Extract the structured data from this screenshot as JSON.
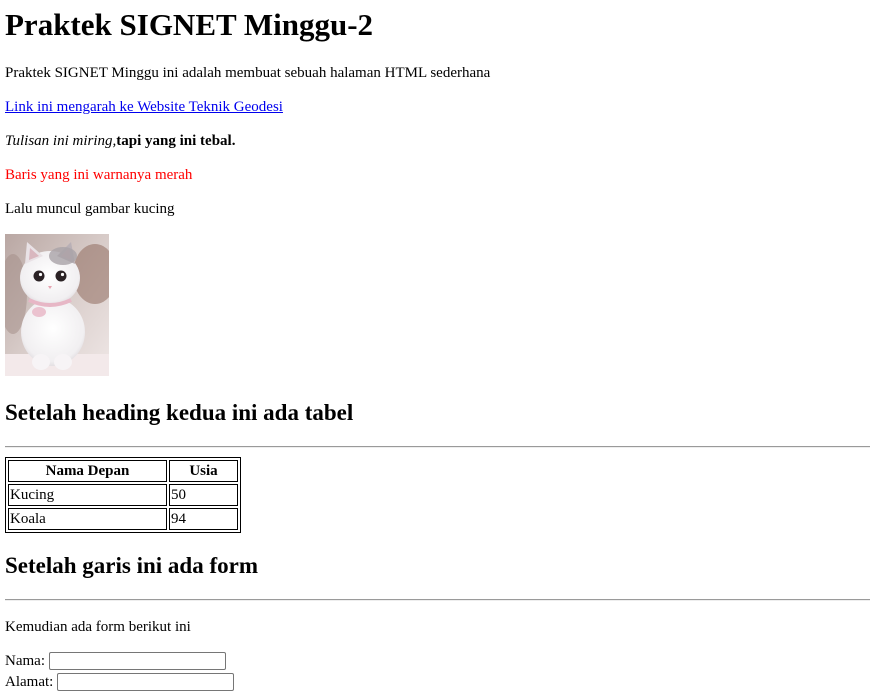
{
  "page": {
    "title": "Praktek SIGNET Minggu-2",
    "intro": "Praktek SIGNET Minggu ini adalah membuat sebuah halaman HTML sederhana",
    "link_text": "Link ini mengarah ke Website Teknik Geodesi",
    "italic_text": "Tulisan ini miring,",
    "bold_text": "tapi yang ini tebal.",
    "red_text": "Baris yang ini warnanya merah",
    "cat_caption": "Lalu muncul gambar kucing",
    "heading_table": "Setelah heading kedua ini ada tabel",
    "heading_form": "Setelah garis ini ada form",
    "form_intro": "Kemudian ada form berikut ini"
  },
  "table": {
    "headers": [
      "Nama Depan",
      "Usia"
    ],
    "rows": [
      [
        "Kucing",
        "50"
      ],
      [
        "Koala",
        "94"
      ]
    ]
  },
  "form": {
    "nama_label": "Nama:",
    "nama_value": "",
    "alamat_label": "Alamat:",
    "alamat_value": ""
  },
  "colors": {
    "link": "#0000ee",
    "red_text": "#ff0000"
  }
}
